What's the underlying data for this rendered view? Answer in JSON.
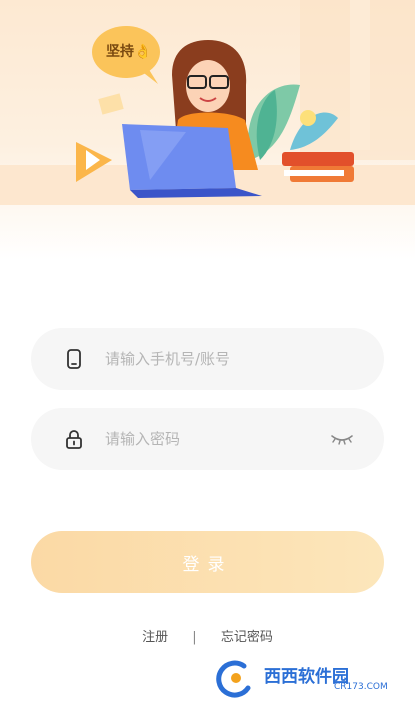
{
  "hero": {
    "bubble_text": "坚持👌"
  },
  "account_field": {
    "placeholder": "请输入手机号/账号",
    "value": ""
  },
  "password_field": {
    "placeholder": "请输入密码",
    "value": ""
  },
  "login_button": {
    "label": "登录"
  },
  "links": {
    "register": "注册",
    "separator": "|",
    "forgot_password": "忘记密码"
  },
  "watermark": {
    "text": "西西软件园",
    "sub": "CR173.COM"
  },
  "colors": {
    "accent": "#fbd9a5",
    "field_bg": "#f6f6f6",
    "placeholder": "#b5b5b5"
  },
  "icons": [
    "phone-icon",
    "lock-icon",
    "eye-closed-icon"
  ]
}
